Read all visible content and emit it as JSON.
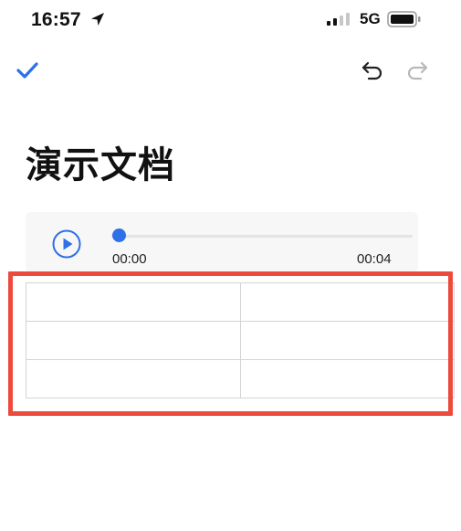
{
  "status_bar": {
    "time": "16:57",
    "network": "5G",
    "icons": [
      "location-arrow-icon",
      "signal-bars-icon",
      "battery-icon"
    ]
  },
  "toolbar": {
    "icons": [
      "checkmark-icon",
      "undo-icon",
      "redo-icon"
    ],
    "accent_color": "#2f6fe8"
  },
  "document": {
    "title": "演示文档"
  },
  "audio_player": {
    "current_time": "00:00",
    "duration": "00:04",
    "progress": 0
  },
  "table": {
    "rows": [
      [
        "",
        ""
      ],
      [
        "",
        ""
      ],
      [
        "",
        ""
      ]
    ]
  },
  "highlight_color": "#ec4a3d"
}
